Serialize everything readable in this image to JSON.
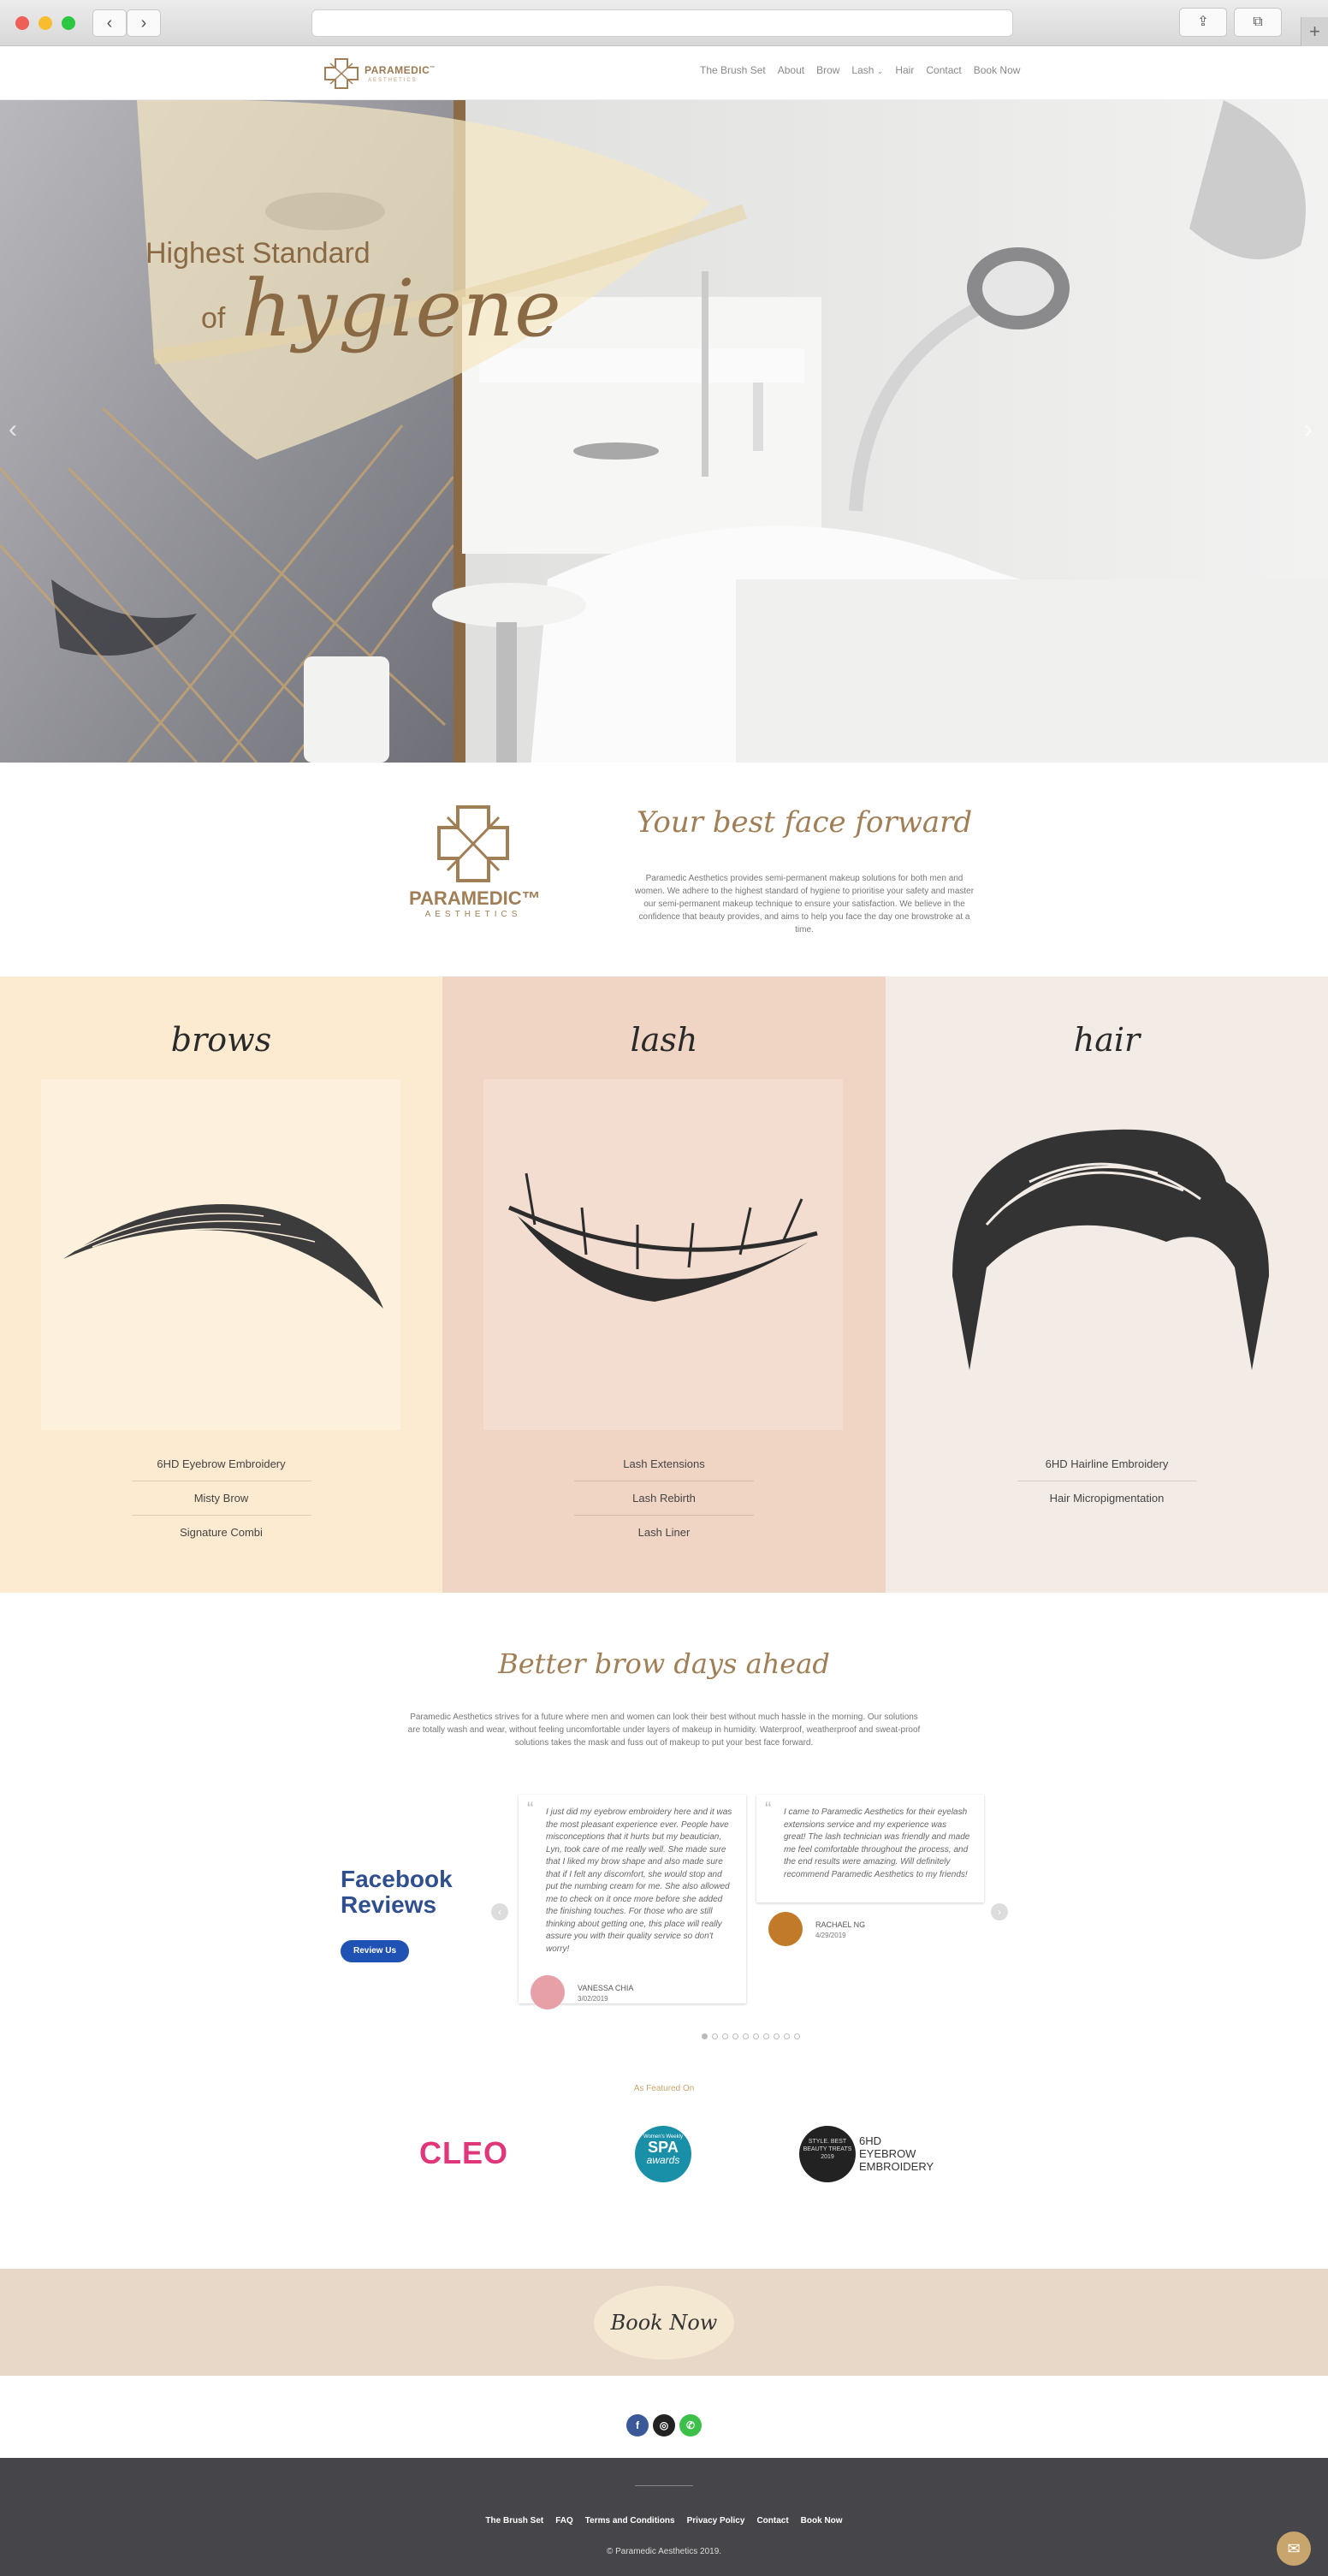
{
  "browser": {
    "back_icon": "‹",
    "forward_icon": "›",
    "share_icon": "⇪",
    "tabs_icon": "⧉",
    "new_tab_icon": "+"
  },
  "header": {
    "logo_name": "PARAMEDIC",
    "logo_tm": "™",
    "logo_sub": "AESTHETICS",
    "nav": [
      "The Brush Set",
      "About",
      "Brow",
      "Lash",
      "Hair",
      "Contact",
      "Book Now"
    ],
    "lash_dropdown": "⌄"
  },
  "hero": {
    "line1": "Highest Standard",
    "of": "of",
    "big": "hygiene",
    "prev": "‹",
    "next": "›"
  },
  "intro": {
    "logo_name": "PARAMEDIC™",
    "logo_sub": "AESTHETICS",
    "title": "Your best face forward",
    "text": "Paramedic Aesthetics provides semi-permanent makeup solutions for both men and women. We adhere to the highest standard of hygiene to prioritise your safety and master our semi-permanent makeup technique to ensure your satisfaction. We believe in the confidence that beauty provides, and aims to help you face the day one browstroke at a time."
  },
  "services": {
    "brows": {
      "title": "brows",
      "items": [
        "6HD Eyebrow Embroidery",
        "Misty Brow",
        "Signature Combi"
      ]
    },
    "lash": {
      "title": "lash",
      "items": [
        "Lash Extensions",
        "Lash Rebirth",
        "Lash Liner"
      ]
    },
    "hair": {
      "title": "hair",
      "items": [
        "6HD Hairline Embroidery",
        "Hair Micropigmentation"
      ]
    }
  },
  "brow_days": {
    "title": "Better brow days ahead",
    "text": "Paramedic Aesthetics strives for a future where men and women can look their best without much hassle in the morning. Our solutions are totally wash and wear, without feeling uncomfortable under layers of makeup in humidity. Waterproof, weatherproof and sweat-proof solutions takes the mask and fuss out of makeup to put your best face forward."
  },
  "reviews": {
    "title_line1": "Facebook",
    "title_line2": "Reviews",
    "button": "Review Us",
    "prev": "‹",
    "next": "›",
    "quote_mark": "“",
    "cards": [
      {
        "text": "I just did my eyebrow embroidery here and it was the most pleasant experience ever. People have misconceptions that it hurts but my beautician, Lyn, took care of me really well. She made sure that I liked my brow shape and also made sure that if I felt any discomfort, she would stop and put the numbing cream for me. She also allowed me to check on it once more before she added the finishing touches. For those who are still thinking about getting one, this place will really assure you with their quality service so don't worry!",
        "name": "VANESSA CHIA",
        "date": "3/02/2019"
      },
      {
        "text": "I came to Paramedic Aesthetics for their eyelash extensions service and my experience was great! The lash technician was friendly and made me feel comfortable throughout the process, and the end results were amazing. Will definitely recommend Paramedic Aesthetics to my friends!",
        "name": "RACHAEL NG",
        "date": "4/29/2019"
      }
    ]
  },
  "featured": {
    "label": "As Featured On",
    "cleo": "CLEO",
    "spa_top": "Women's Weekly",
    "spa_mid": "SPA",
    "spa_bot": "awards",
    "style_badge": "STYLE. BEST BEAUTY TREATS 2019",
    "sixhd_lines": [
      "6HD",
      "EYEBROW",
      "EMBROIDERY"
    ]
  },
  "book": {
    "label": "Book Now"
  },
  "social": {
    "facebook": "f",
    "instagram": "◎",
    "whatsapp": "✆"
  },
  "footer": {
    "links": [
      "The Brush Set",
      "FAQ",
      "Terms and Conditions",
      "Privacy Policy",
      "Contact",
      "Book Now"
    ],
    "copyright": "© Paramedic Aesthetics 2019.",
    "messenger_icon": "✉"
  },
  "colors": {
    "brand_gold": "#a07e56",
    "brows_bg": "#fcebd0",
    "lash_bg": "#f0d5c5",
    "hair_bg": "#f3ebe5",
    "facebook_blue": "#1f52b3",
    "footer_bg": "#464549"
  }
}
